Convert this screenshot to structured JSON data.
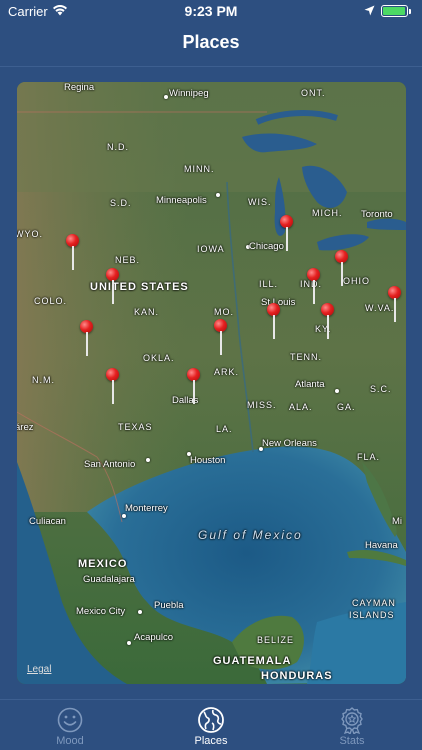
{
  "status_bar": {
    "carrier": "Carrier",
    "time": "9:23 PM"
  },
  "nav": {
    "title": "Places"
  },
  "map": {
    "legal": "Legal",
    "labels": {
      "regina": "Regina",
      "winnipeg": "Winnipeg",
      "ont": "ONT.",
      "nd": "N.D.",
      "minn": "MINN.",
      "minneapolis": "Minneapolis",
      "sd": "S.D.",
      "wis": "WIS.",
      "mich": "MICH.",
      "toronto": "Toronto",
      "wyo": "WYO.",
      "neb": "NEB.",
      "iowa": "IOWA",
      "chicago": "Chicago",
      "united_states": "UNITED STATES",
      "ill": "ILL.",
      "ind": "IND.",
      "ohio": "OHIO",
      "colo": "COLO.",
      "kan": "KAN.",
      "mo": "MO.",
      "st_louis": "St Louis",
      "wva": "W.VA.",
      "ky": "KY.",
      "okla": "OKLA.",
      "tenn": "TENN.",
      "nm": "N.M.",
      "ark": "ARK.",
      "atlanta": "Atlanta",
      "sc": "S.C.",
      "dallas": "Dallas",
      "miss": "MISS.",
      "ala": "ALA.",
      "ga": "GA.",
      "juarez": "árez",
      "texas": "TEXAS",
      "la": "LA.",
      "new_orleans": "New Orleans",
      "fla": "FLA.",
      "san_antonio": "San Antonio",
      "houston": "Houston",
      "monterrey": "Monterrey",
      "culiacan": "Culiacan",
      "gulf": "Gulf of Mexico",
      "mi": "Mi",
      "havana": "Havana",
      "mexico": "MEXICO",
      "guadalajara": "Guadalajara",
      "mexico_city": "Mexico City",
      "puebla": "Puebla",
      "cayman": "CAYMAN",
      "islands": "ISLANDS",
      "acapulco": "Acapulco",
      "belize": "BELIZE",
      "guatemala": "GUATEMALA",
      "honduras": "HONDURAS"
    }
  },
  "tabs": [
    {
      "label": "Mood",
      "icon": "smiley-icon",
      "active": false
    },
    {
      "label": "Places",
      "icon": "globe-icon",
      "active": true
    },
    {
      "label": "Stats",
      "icon": "award-ribbon-icon",
      "active": false
    }
  ],
  "colors": {
    "background": "#2d4f80",
    "tab_inactive": "#7e98bd",
    "pin": "#e52020",
    "battery": "#4cd964"
  }
}
